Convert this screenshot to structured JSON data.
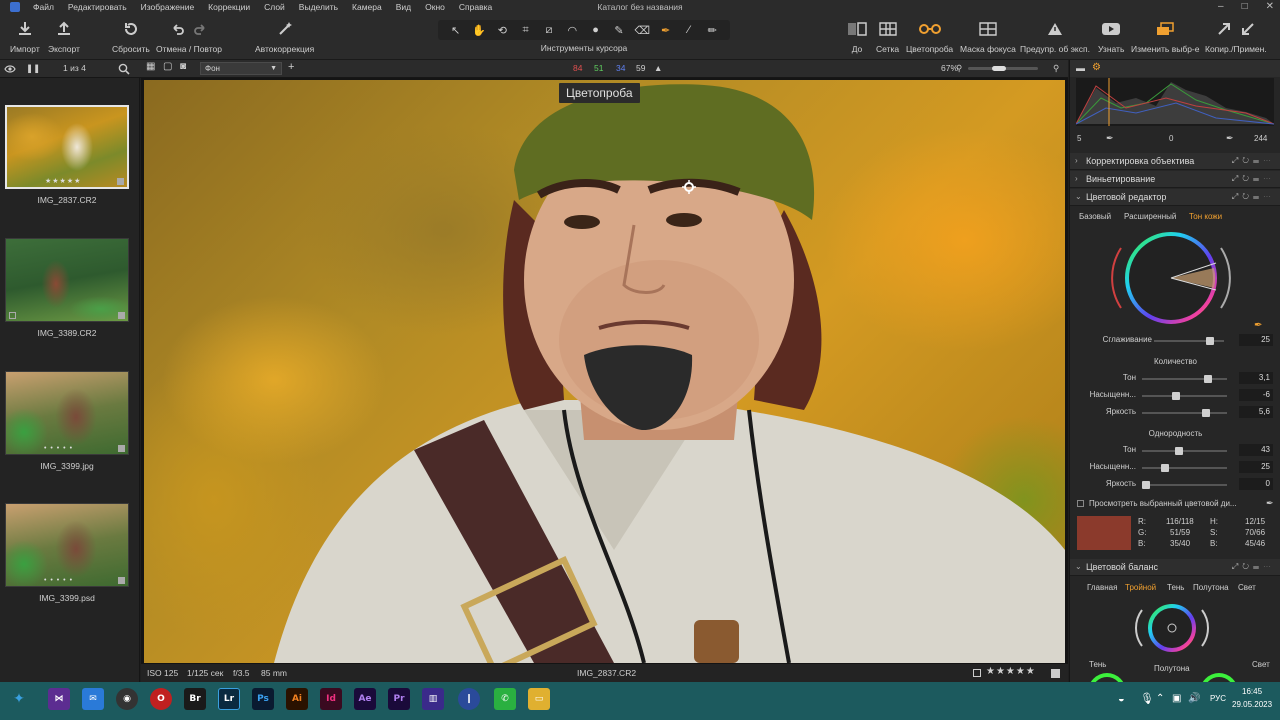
{
  "app": {
    "title": "Каталог без названия",
    "menu": [
      "Файл",
      "Редактировать",
      "Изображение",
      "Коррекции",
      "Слой",
      "Выделить",
      "Камера",
      "Вид",
      "Окно",
      "Справка"
    ]
  },
  "toolbar": {
    "import": "Импорт",
    "export": "Экспорт",
    "reset": "Сбросить",
    "undo_redo": "Отмена / Повтор",
    "autocorrect": "Автокоррекция",
    "cursor_tools": "Инструменты курсора",
    "before": "До",
    "grid": "Сетка",
    "color_picker": "Цветопроба",
    "focus_mask": "Маска фокуса",
    "exposure_warning": "Предупр. об эксп.",
    "learn": "Узнать",
    "edit_selected": "Изменить выбр-е",
    "copy_apply": "Копир./Примен."
  },
  "subbar": {
    "counter": "1 из 4",
    "layer": "Фон",
    "rgb": {
      "r": "84",
      "g": "51",
      "b": "34",
      "l": "59"
    },
    "zoom": "67%"
  },
  "filmstrip": [
    {
      "name": "IMG_2837.CR2",
      "stars": "★★★★★",
      "selected": true
    },
    {
      "name": "IMG_3389.CR2",
      "stars": "• • • • •",
      "selected": false
    },
    {
      "name": "IMG_3399.jpg",
      "stars": "• • • • •",
      "selected": false
    },
    {
      "name": "IMG_3399.psd",
      "stars": "• • • • •",
      "selected": false
    }
  ],
  "viewer": {
    "tooltip": "Цветопроба"
  },
  "statusbar": {
    "iso": "ISO 125",
    "shutter": "1/125 сек",
    "aperture": "f/3.5",
    "focal": "85 mm",
    "filename": "IMG_2837.CR2",
    "rating": "★★★★★"
  },
  "right_panel": {
    "levels": {
      "low": "5",
      "mid": "0",
      "high": "244"
    },
    "lens_correction": "Корректировка объектива",
    "vignetting": "Виньетирование",
    "color_editor": "Цветовой редактор",
    "ce_tabs": [
      "Базовый",
      "Расширенный",
      "Тон кожи"
    ],
    "smoothing_label": "Сглаживание",
    "smoothing_value": "25",
    "amount_title": "Количество",
    "amount": [
      {
        "label": "Тон",
        "value": "3,1",
        "pos": 0.78
      },
      {
        "label": "Насыщенн...",
        "value": "-6",
        "pos": 0.4
      },
      {
        "label": "Яркость",
        "value": "5,6",
        "pos": 0.76
      }
    ],
    "uniformity_title": "Однородность",
    "uniformity": [
      {
        "label": "Тон",
        "value": "43",
        "pos": 0.43
      },
      {
        "label": "Насыщенн...",
        "value": "25",
        "pos": 0.25
      },
      {
        "label": "Яркость",
        "value": "0",
        "pos": 0.0
      }
    ],
    "view_selected": "Просмотреть выбранный цветовой ди...",
    "color_readout": {
      "r_label": "R:",
      "r_value": "116/118",
      "g_label": "G:",
      "g_value": "51/59",
      "b_label": "B:",
      "b_value": "35/40",
      "h_label": "H:",
      "h_value": "12/15",
      "s_label": "S:",
      "s_value": "70/66",
      "bb_label": "B:",
      "bb_value": "45/46"
    },
    "swatch_color": "#8b3a2c",
    "color_balance": "Цветовой баланс",
    "cb_tabs": [
      "Главная",
      "Тройной",
      "Тень",
      "Полутона",
      "Свет"
    ],
    "cb_labels": {
      "shadow": "Тень",
      "mid": "Полутона",
      "light": "Свет"
    }
  },
  "taskbar": {
    "lang": "РУС",
    "time": "16:45",
    "date": "29.05.2023",
    "apps": [
      "Br",
      "Lr",
      "Ps",
      "Ai",
      "Id",
      "Ae",
      "Pr"
    ]
  },
  "colors": {
    "accent": "#f0a030",
    "panel": "#262626",
    "taskbar": "#1c5a5e"
  }
}
